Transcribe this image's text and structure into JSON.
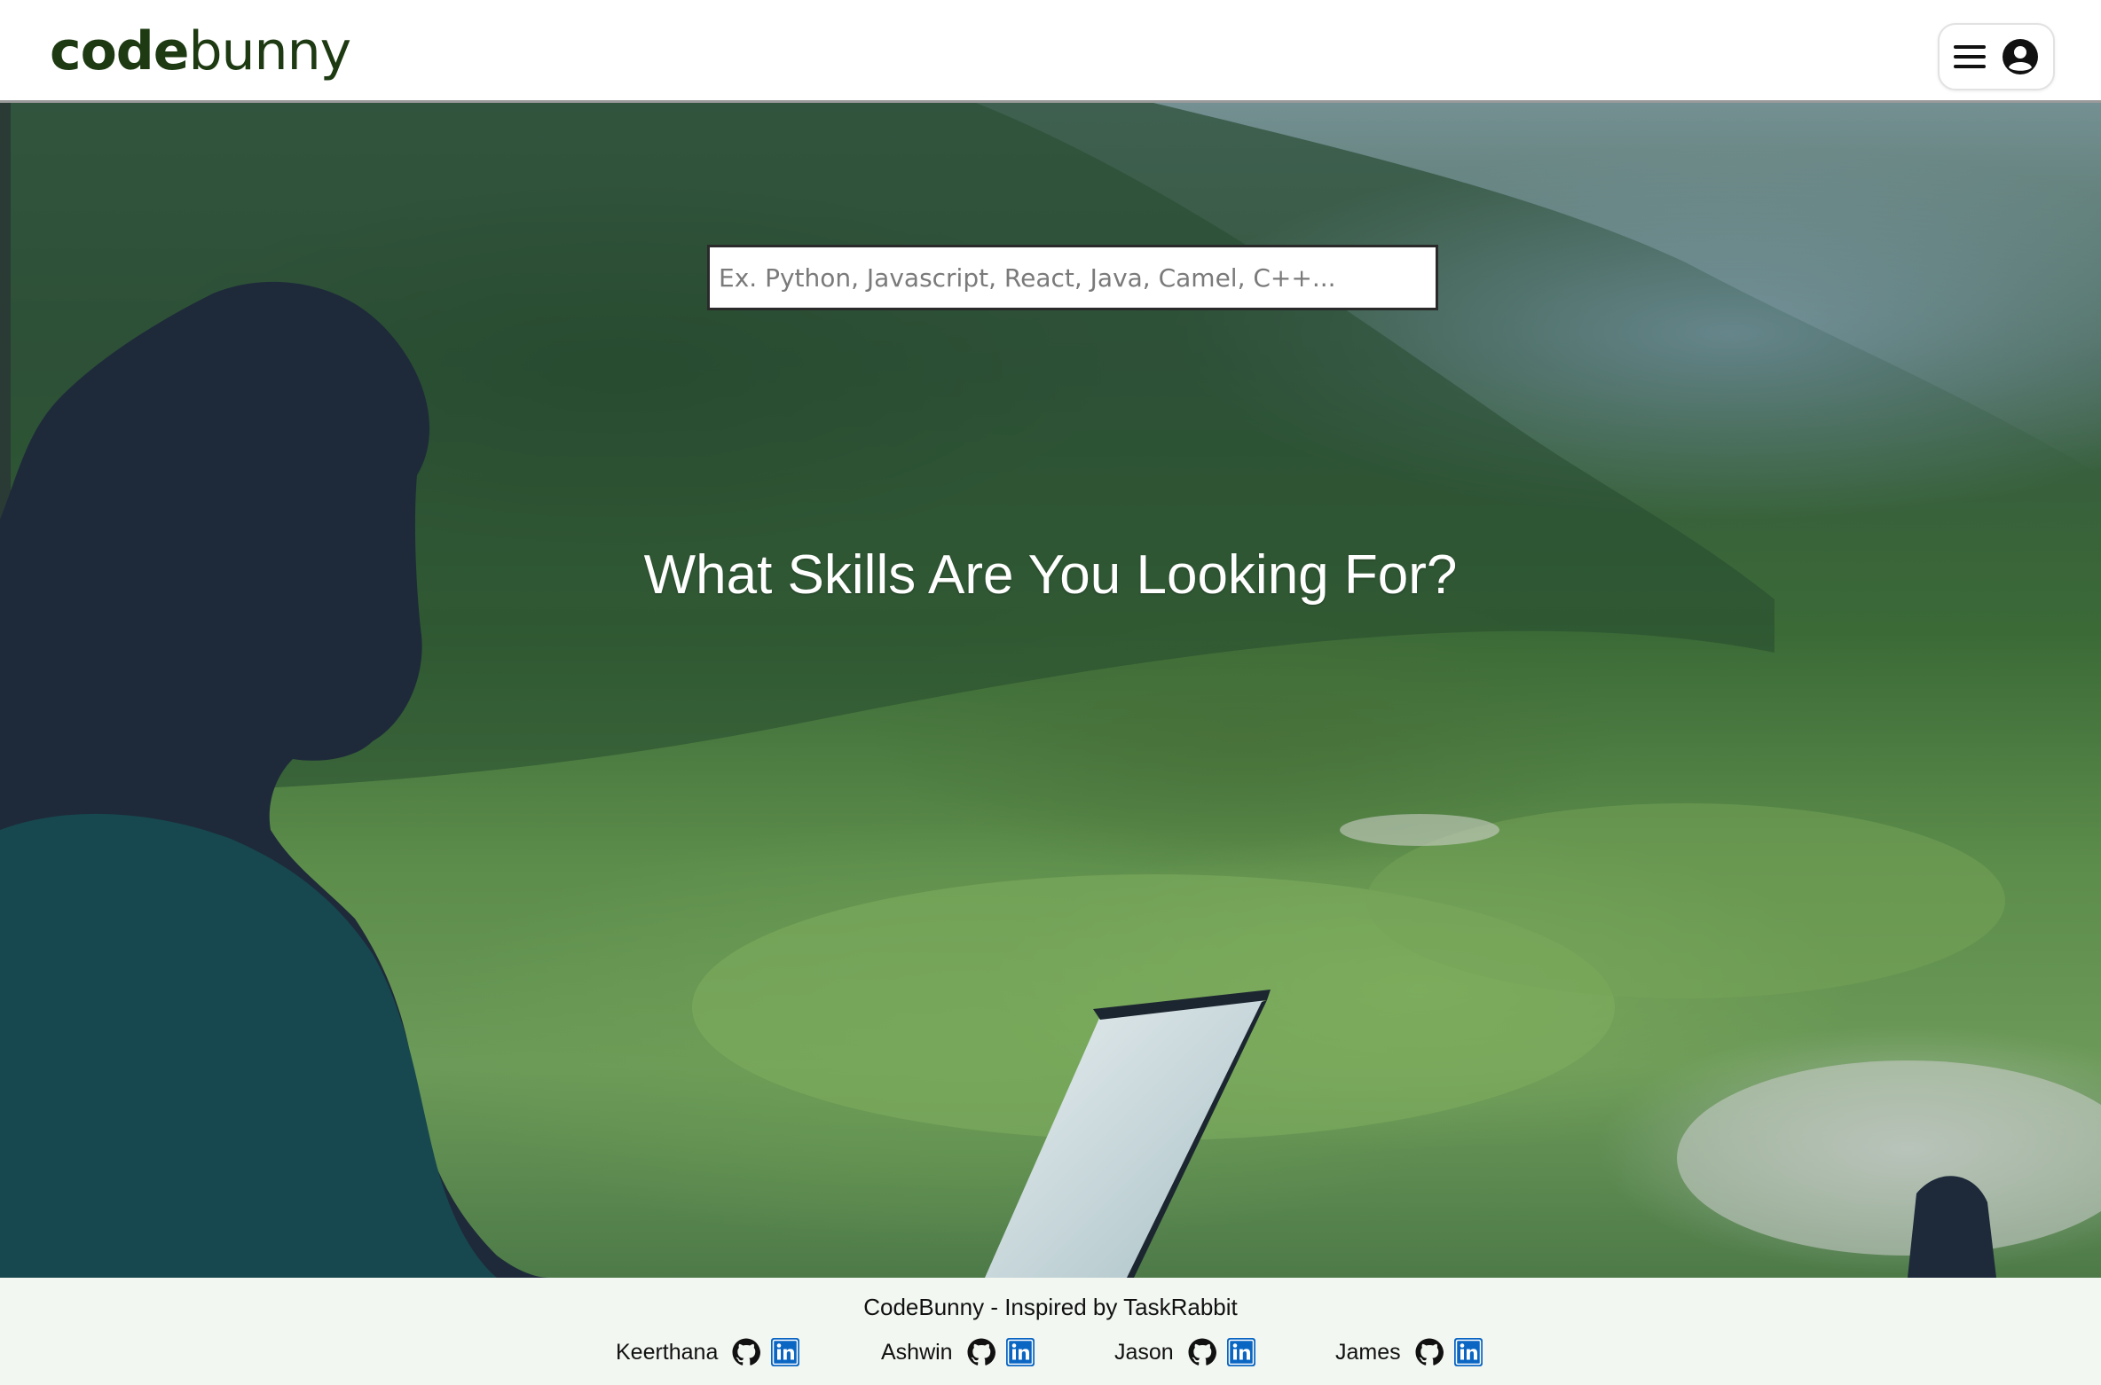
{
  "header": {
    "logo_bold": "code",
    "logo_light": "bunny",
    "menu_icon": "hamburger-menu-icon",
    "account_icon": "user-circle-icon"
  },
  "search": {
    "placeholder": "Ex. Python, Javascript, React, Java, Camel, C++..."
  },
  "hero": {
    "title": "What Skills Are You Looking For?",
    "background_image": "woman with laptop overlooking green mountain valley"
  },
  "footer": {
    "tagline": "CodeBunny - Inspired by TaskRabbit",
    "credits": [
      {
        "name": "Keerthana",
        "icons": [
          "github-icon",
          "linkedin-icon"
        ]
      },
      {
        "name": "Ashwin",
        "icons": [
          "github-icon",
          "linkedin-icon"
        ]
      },
      {
        "name": "Jason",
        "icons": [
          "github-icon",
          "linkedin-icon"
        ]
      },
      {
        "name": "James",
        "icons": [
          "github-icon",
          "linkedin-icon"
        ]
      }
    ]
  },
  "colors": {
    "logo": "#1d3a12",
    "footer_bg": "#f2f7f1",
    "linkedin_blue": "#0a66c2",
    "hero_title": "#ffffff"
  }
}
